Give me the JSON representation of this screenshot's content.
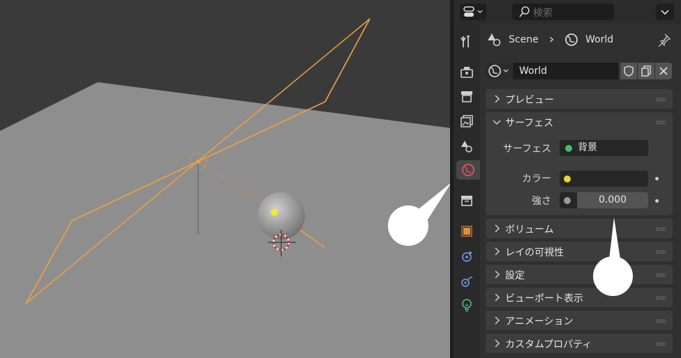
{
  "colors": {
    "accent_orange": "#f0a040",
    "world_icon_red": "#e2525f",
    "socket_green": "#3fbf5f",
    "socket_yellow": "#e5d62f",
    "socket_grey": "#9a9a9a",
    "panel_bg": "#303030",
    "section_bg": "#3d3d3d"
  },
  "viewport": {
    "objects": [
      "area-light-outline",
      "point-light",
      "sphere",
      "3d-cursor"
    ]
  },
  "header": {
    "editor_type_icon": "properties-editor-icon",
    "search_placeholder": "検索",
    "options_icon": "chevron-down-icon"
  },
  "tabs": [
    "tool-icon",
    "render-icon",
    "output-icon",
    "view-layer-icon",
    "scene-icon",
    "world-icon",
    "collection-icon",
    "object-icon",
    "modifier-icon",
    "physics-icon",
    "object-data-icon"
  ],
  "breadcrumb": {
    "scene": "Scene",
    "separator": "›",
    "world": "World"
  },
  "datablock": {
    "name": "World"
  },
  "sections": {
    "preview": "プレビュー",
    "surface": "サーフェス",
    "volume": "ボリューム",
    "ray_visibility": "レイの可視性",
    "settings": "設定",
    "viewport_display": "ビューポート表示",
    "animation": "アニメーション",
    "custom_props": "カスタムプロパティ"
  },
  "surface": {
    "surface_label": "サーフェス",
    "surface_value": "背景",
    "color_label": "カラー",
    "strength_label": "強さ",
    "strength_value": "0.000"
  }
}
